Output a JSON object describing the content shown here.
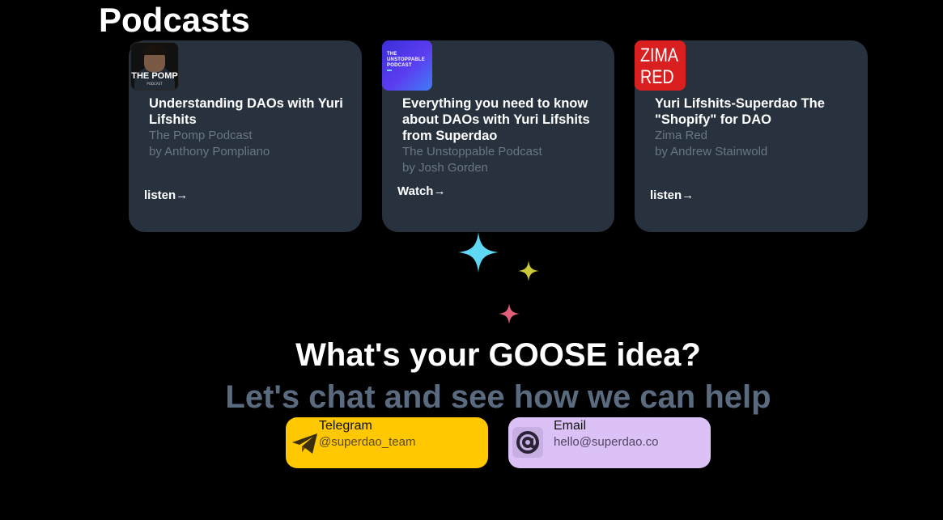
{
  "podcasts": {
    "heading": "Podcasts",
    "cards": [
      {
        "cover_title": "THE POMP",
        "cover_subtitle": "PODCAST",
        "title": "Understanding DAOs with Yuri Lifshits",
        "show": "The Pomp Podcast",
        "author": "by Anthony Pompliano",
        "link_label": "listen→"
      },
      {
        "cover_title": "THE UNSTOPPABLE PODCAST",
        "title": "Everything you need to know about DAOs with Yuri Lifshits from Superdao",
        "show": "The Unstoppable Podcast",
        "author": "by Josh Gorden",
        "link_label": "Watch→"
      },
      {
        "cover_title": "ZIMA RED",
        "title": "Yuri Lifshits-Superdao The \"Shopify\" for DAO",
        "show": "Zima Red",
        "author": "by Andrew Stainwold",
        "link_label": "listen→"
      }
    ]
  },
  "sparkle_colors": [
    "#5fd8f5",
    "#c9c93a",
    "#e0607a"
  ],
  "cta": {
    "title": "What's your GOOSE idea?",
    "subtitle": "Let's chat and see how we can help"
  },
  "contacts": {
    "telegram": {
      "label": "Telegram",
      "value": "@superdao_team",
      "icon": "telegram-plane-icon",
      "color": "#ffc800"
    },
    "email": {
      "label": "Email",
      "value": "hello@superdao.co",
      "icon": "at-sign-icon",
      "color": "#dcc1f7"
    }
  }
}
